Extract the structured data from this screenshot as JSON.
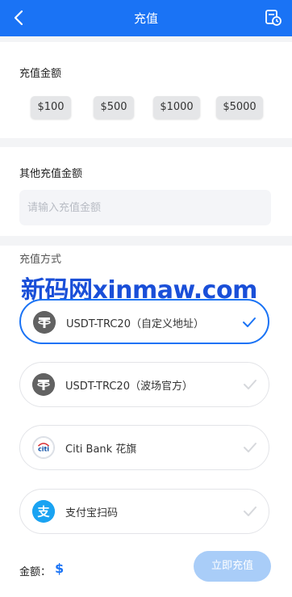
{
  "header": {
    "title": "充值",
    "back_icon": "chevron-left-icon",
    "record_icon": "recharge-record-icon",
    "color": "#1a73f5"
  },
  "quick_amounts": {
    "label": "充值金额",
    "options": [
      "$100",
      "$500",
      "$1000",
      "$5000"
    ]
  },
  "custom_amount": {
    "label": "其他充值金额",
    "placeholder": "请输入充值金额",
    "value": ""
  },
  "payment": {
    "label": "充值方式",
    "watermark": "新码网xinmaw.com",
    "methods": [
      {
        "label": "USDT-TRC20（自定义地址）",
        "icon": "tether-icon",
        "selected": true
      },
      {
        "label": "USDT-TRC20（波场官方）",
        "icon": "tether-icon",
        "selected": false
      },
      {
        "label": "Citi Bank 花旗",
        "icon": "citi-bank-icon",
        "selected": false
      },
      {
        "label": "支付宝扫码",
        "icon": "alipay-icon",
        "selected": false
      }
    ]
  },
  "footer": {
    "amount_label": "金额：",
    "currency": "$",
    "submit_label": "立即充值"
  }
}
